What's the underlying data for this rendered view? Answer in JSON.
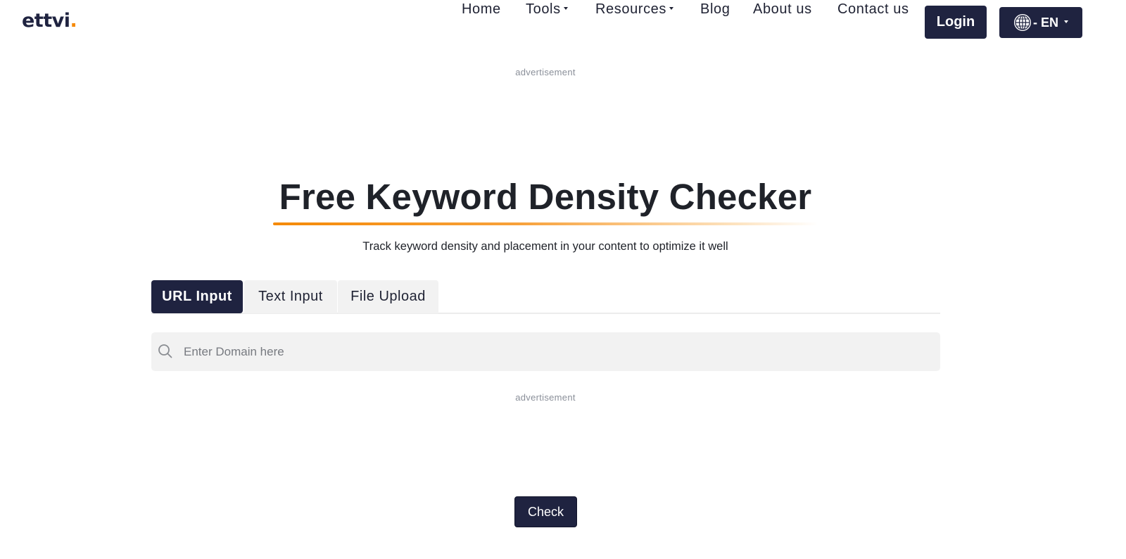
{
  "brand": {
    "logo_text": "ettvi",
    "logo_dot": ".",
    "accent_color": "#f58a07",
    "primary_color": "#1f2340"
  },
  "nav": {
    "items": [
      {
        "label": "Home",
        "has_dropdown": false
      },
      {
        "label": "Tools",
        "has_dropdown": true
      },
      {
        "label": "Resources",
        "has_dropdown": true
      },
      {
        "label": "Blog",
        "has_dropdown": false
      },
      {
        "label": "About us",
        "has_dropdown": false
      },
      {
        "label": "Contact us",
        "has_dropdown": false
      }
    ],
    "login_label": "Login",
    "language": {
      "icon": "globe-icon",
      "label": "- EN"
    }
  },
  "ads": {
    "top_label": "advertisement",
    "bottom_label": "advertisement"
  },
  "hero": {
    "title": "Free Keyword Density Checker",
    "subtitle": "Track keyword density and placement in your content to optimize it well"
  },
  "tabs": [
    {
      "label": "URL Input",
      "active": true
    },
    {
      "label": "Text Input",
      "active": false
    },
    {
      "label": "File Upload",
      "active": false
    }
  ],
  "search": {
    "icon": "search-icon",
    "value": "",
    "placeholder": "Enter Domain here"
  },
  "actions": {
    "check_label": "Check"
  }
}
